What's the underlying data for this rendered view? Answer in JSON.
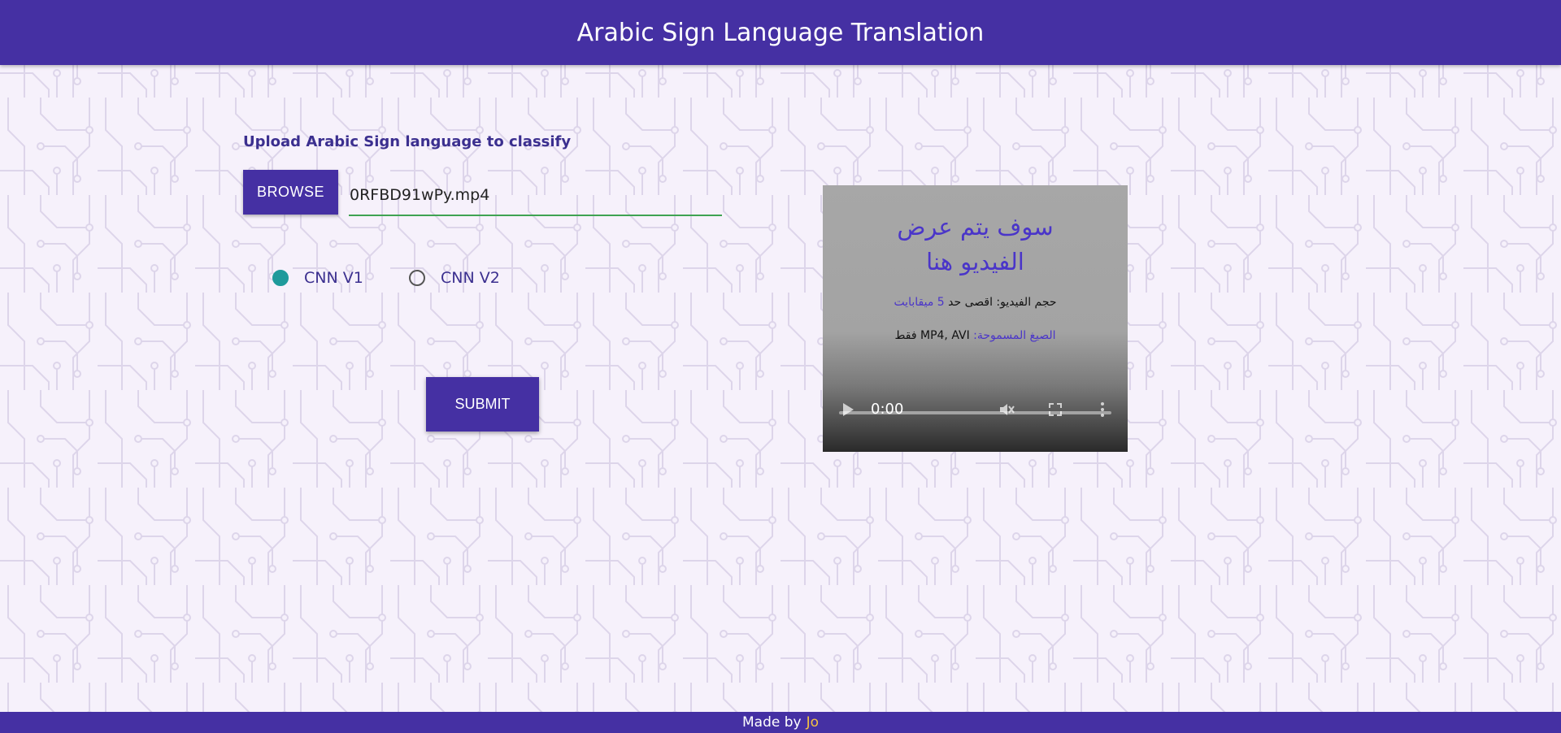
{
  "header": {
    "title": "Arabic Sign Language Translation"
  },
  "upload": {
    "label": "Upload Arabic Sign language to classify",
    "browse_label": "BROWSE",
    "file_name": "0RFBD91wPy.mp4"
  },
  "model_options": [
    {
      "label": "CNN V1",
      "selected": true
    },
    {
      "label": "CNN V2",
      "selected": false
    }
  ],
  "submit_label": "SUBMIT",
  "video": {
    "title_line1": "سوف يتم عرض",
    "title_line2": "الفيديو هنا",
    "size_prefix": "حجم الفيديو: اقصى حد ",
    "size_value": "5 ميقابايت",
    "formats_label": "الصيغ المسموحة: ",
    "formats_value": "MP4, AVI فقط",
    "time": "0:00",
    "progress": 0
  },
  "footer": {
    "made_by": "Made by",
    "author": "Jo"
  },
  "colors": {
    "brand": "#4530a3",
    "accent_text": "#4a35c9",
    "radio_checked": "#1e9a9b",
    "input_underline": "#3fa352",
    "footer_author": "#f5c242"
  }
}
